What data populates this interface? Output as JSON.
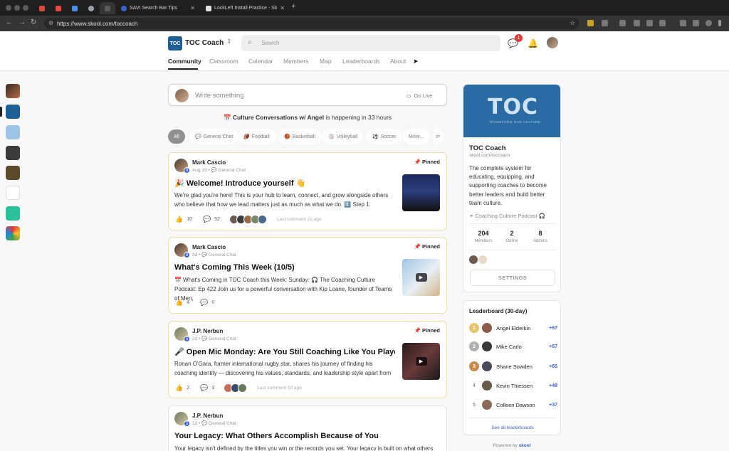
{
  "browser": {
    "tabs": [
      {
        "label": "",
        "color": "#dd4b3e"
      },
      {
        "label": "",
        "color": "#e8453c"
      },
      {
        "label": "",
        "color": "#4a8ee8"
      },
      {
        "label": "",
        "color": "#9aa0a6"
      },
      {
        "label": "",
        "color": "#5b5b5b"
      },
      {
        "label": "SAVI Search Bar Tips",
        "color": "#3c63c9"
      },
      {
        "label": "LockLeft Install Practice - Sk",
        "color": "#e0e0e0"
      }
    ],
    "url": "https://www.skool.com/toccoach"
  },
  "header": {
    "logo_text": "TOC",
    "group_name": "TOC Coach",
    "search_placeholder": "Search",
    "notification_count": "1",
    "nav_tabs": [
      "Community",
      "Classroom",
      "Calendar",
      "Members",
      "Map",
      "Leaderboards",
      "About"
    ]
  },
  "composer": {
    "placeholder": "Write something",
    "go_live": "Go Live"
  },
  "event": {
    "name": "Culture Conversations w/ Angel",
    "suffix": " is happening in 33 hours"
  },
  "filters": [
    "All",
    "General Chat",
    "Football",
    "Basketball",
    "Volleyball",
    "Soccer",
    "More..."
  ],
  "posts": [
    {
      "author": "Mark Cascio",
      "level": "8",
      "meta": "Aug 19 • 💬 General Chat",
      "pinned": "Pinned",
      "title": "🎉 Welcome! Introduce yourself 👋",
      "excerpt": "We're glad you're here! This is your hub to learn, connect, and grow alongside others who believe that how we lead matters just as much as what we do. 1️⃣ Step 1:",
      "likes": "10",
      "comments": "52",
      "last_comment": "Last comment 2d ago"
    },
    {
      "author": "Mark Cascio",
      "level": "8",
      "meta": "3d • 💬 General Chat",
      "pinned": "Pinned",
      "title": "What's Coming This Week (10/5)",
      "excerpt": "📅 What's Coming in TOC Coach this Week: Sunday: 🎧 The Coaching Culture Podcast: Ep 422 Join us for a powerful conversation with Kip Loane, founder of Teams of Men,",
      "likes": "4",
      "comments": "0",
      "last_comment": ""
    },
    {
      "author": "J.P. Nerbun",
      "level": "5",
      "meta": "2d • 💬 General Chat",
      "pinned": "Pinned",
      "title": "🎤 Open Mic Monday: Are You Still Coaching Like You Played?",
      "excerpt": "Ronan O'Gara, former international rugby star, shares his journey of finding his coaching identity — discovering his values, standards, and leadership style apart from",
      "likes": "2",
      "comments": "3",
      "last_comment": "Last comment 1d ago"
    },
    {
      "author": "J.P. Nerbun",
      "level": "5",
      "meta": "1d • 💬 General Chat",
      "pinned": "",
      "title": "Your Legacy: What Others Accomplish Because of You",
      "excerpt": "Your legacy isn't defined by the titles you win or the records you set. Your legacy is built on what others"
    }
  ],
  "about": {
    "cover_text": "TOC",
    "cover_sub": "TRANSFORM OUR CULTURE",
    "name": "TOC Coach",
    "url": "skool.com/toccoach",
    "description": "The complete system for educating, equipping, and supporting coaches to become better leaders and build better team culture.",
    "link": "Coaching Culture Podcast 🎧",
    "stats": [
      {
        "n": "204",
        "l": "Members"
      },
      {
        "n": "2",
        "l": "Online"
      },
      {
        "n": "8",
        "l": "Admins"
      }
    ],
    "settings": "SETTINGS"
  },
  "leaderboard": {
    "title": "Leaderboard (30-day)",
    "rows": [
      {
        "rank": "1",
        "name": "Angel Elderkin",
        "pts": "+67"
      },
      {
        "rank": "2",
        "name": "Mike Carlo",
        "pts": "+67"
      },
      {
        "rank": "3",
        "name": "Shane Sowden",
        "pts": "+65"
      },
      {
        "rank": "4",
        "name": "Kevin Thiessen",
        "pts": "+48"
      },
      {
        "rank": "5",
        "name": "Colleen Dawson",
        "pts": "+37"
      }
    ],
    "see_all": "See all leaderboards"
  },
  "powered_by": "Powered by",
  "powered_brand": "skool",
  "colors": {
    "accent": "#3c63c9",
    "pinned_border": "#f2dea0",
    "brand_blue": "#1e5f95"
  }
}
